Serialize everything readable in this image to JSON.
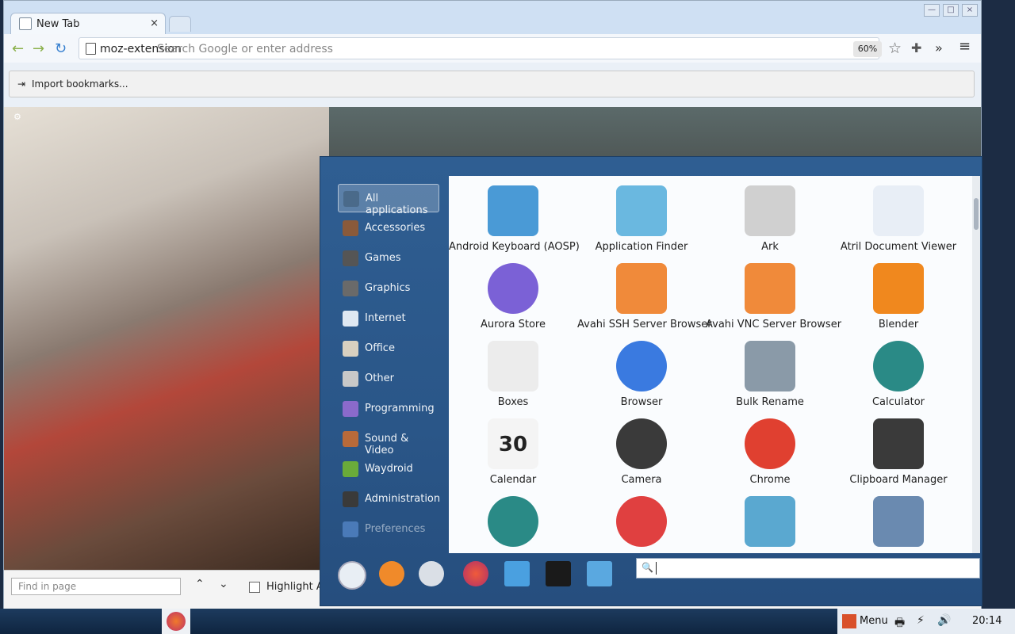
{
  "browser": {
    "tab_title": "New Tab",
    "tab_close": "×",
    "url_text": "moz-extension",
    "url_placeholder": "Search Google or enter address",
    "zoom": "60%",
    "star": "☆",
    "extensions_icon": "✚",
    "overflow": "»",
    "menu": "≡",
    "window_controls": [
      "—",
      "□",
      "×"
    ],
    "import_bookmarks": "Import bookmarks...",
    "find_placeholder": "Find in page",
    "find_prev": "⌃",
    "find_next": "⌄",
    "highlight_all": "Highlight All"
  },
  "app_menu": {
    "categories": [
      {
        "label": "All applications",
        "color": "#4a6a8a"
      },
      {
        "label": "Accessories",
        "color": "#8a5a3a"
      },
      {
        "label": "Games",
        "color": "#555555"
      },
      {
        "label": "Graphics",
        "color": "#6a6a6a"
      },
      {
        "label": "Internet",
        "color": "#dfe8f2"
      },
      {
        "label": "Office",
        "color": "#d8d0c0"
      },
      {
        "label": "Other",
        "color": "#c8c8c8"
      },
      {
        "label": "Programming",
        "color": "#8a6acb"
      },
      {
        "label": "Sound & Video",
        "color": "#b86a3a"
      },
      {
        "label": "Waydroid",
        "color": "#6aab3a"
      },
      {
        "label": "Administration",
        "color": "#3a3a3a"
      },
      {
        "label": "Preferences",
        "color": "#4a7ab8"
      }
    ],
    "apps": [
      {
        "label": "Android Keyboard (AOSP)",
        "icon": "keyboard-icon",
        "color": "#4a9ad6"
      },
      {
        "label": "Application Finder",
        "icon": "magnifier-icon",
        "color": "#6ab8e0"
      },
      {
        "label": "Ark",
        "icon": "archive-icon",
        "color": "#d0d0d0"
      },
      {
        "label": "Atril Document Viewer",
        "icon": "document-viewer-icon",
        "color": "#e8eef6"
      },
      {
        "label": "Aurora Store",
        "icon": "aurora-store-icon",
        "color": "#7b61d6"
      },
      {
        "label": "Avahi SSH Server Browser",
        "icon": "avahi-ssh-icon",
        "color": "#f08a3a"
      },
      {
        "label": "Avahi VNC Server Browser",
        "icon": "avahi-vnc-icon",
        "color": "#f08a3a"
      },
      {
        "label": "Blender",
        "icon": "blender-icon",
        "color": "#f0881e"
      },
      {
        "label": "Boxes",
        "icon": "boxes-icon",
        "color": "#ececec"
      },
      {
        "label": "Browser",
        "icon": "browser-icon",
        "color": "#3a7ae0"
      },
      {
        "label": "Bulk Rename",
        "icon": "bulk-rename-icon",
        "color": "#8a9aa8"
      },
      {
        "label": "Calculator",
        "icon": "calculator-icon",
        "color": "#2a8a86"
      },
      {
        "label": "Calendar",
        "icon": "calendar-icon",
        "color": "#f4f4f4",
        "badge": "30"
      },
      {
        "label": "Camera",
        "icon": "camera-icon",
        "color": "#3a3a3a"
      },
      {
        "label": "Chrome",
        "icon": "chrome-icon",
        "color": "#e04030"
      },
      {
        "label": "Clipboard Manager",
        "icon": "clipboard-icon",
        "color": "#3a3a3a"
      },
      {
        "label": "",
        "icon": "clock-icon",
        "color": "#2a8a86"
      },
      {
        "label": "",
        "icon": "connections-icon",
        "color": "#e04040"
      },
      {
        "label": "",
        "icon": "dictionary-icon",
        "color": "#5aa8d0"
      },
      {
        "label": "",
        "icon": "disk-icon",
        "color": "#6a8ab0"
      }
    ],
    "bottom": {
      "power": "power-icon",
      "logout": "logout-icon",
      "lock": "lock-icon",
      "firefox": "firefox-icon",
      "files": "files-icon",
      "terminal": "terminal-icon",
      "search_files": "search-files-icon",
      "search_icon": "🔍"
    }
  },
  "taskbar": {
    "menu_label": "Menu",
    "clock": "20:14",
    "printer": "🖶",
    "network": "⚡",
    "volume": "🔊"
  }
}
